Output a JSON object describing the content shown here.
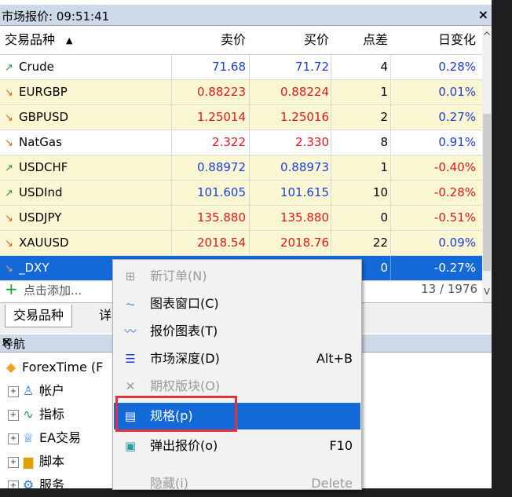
{
  "market_watch": {
    "title": "市场报价: 09:51:41",
    "close": "×",
    "headers": {
      "symbol": "交易品种",
      "bid": "卖价",
      "ask": "买价",
      "spread": "点差",
      "change": "日变化"
    },
    "sort_glyph": "▲",
    "rows": [
      {
        "dir": "↗",
        "symbol": "Crude",
        "bid": "71.68",
        "ask": "71.72",
        "spread": "4",
        "change": "0.28%"
      },
      {
        "dir": "↘",
        "symbol": "EURGBP",
        "bid": "0.88223",
        "ask": "0.88224",
        "spread": "1",
        "change": "0.01%"
      },
      {
        "dir": "↘",
        "symbol": "GBPUSD",
        "bid": "1.25014",
        "ask": "1.25016",
        "spread": "2",
        "change": "0.27%"
      },
      {
        "dir": "↘",
        "symbol": "NatGas",
        "bid": "2.322",
        "ask": "2.330",
        "spread": "8",
        "change": "0.91%"
      },
      {
        "dir": "↗",
        "symbol": "USDCHF",
        "bid": "0.88972",
        "ask": "0.88973",
        "spread": "1",
        "change": "-0.40%"
      },
      {
        "dir": "↗",
        "symbol": "USDInd",
        "bid": "101.605",
        "ask": "101.615",
        "spread": "10",
        "change": "-0.28%"
      },
      {
        "dir": "↘",
        "symbol": "USDJPY",
        "bid": "135.880",
        "ask": "135.880",
        "spread": "0",
        "change": "-0.51%"
      },
      {
        "dir": "↘",
        "symbol": "XAUUSD",
        "bid": "2018.54",
        "ask": "2018.76",
        "spread": "22",
        "change": "0.09%"
      },
      {
        "dir": "↘",
        "symbol": "_DXY",
        "bid": "",
        "ask": "",
        "spread": "0",
        "change": "-0.27%"
      }
    ],
    "add_row": {
      "plus": "+",
      "label": "点击添加...",
      "count": "13 / 1976"
    },
    "tabs": {
      "symbols": "交易品种",
      "details": "详"
    }
  },
  "navigator": {
    "title": "导航",
    "close": "×",
    "items": [
      {
        "label": "ForexTime (F",
        "icon": "forextime-logo-icon"
      },
      {
        "label": "帐户",
        "icon": "accounts-icon"
      },
      {
        "label": "指标",
        "icon": "indicators-icon"
      },
      {
        "label": "EA交易",
        "icon": "expert-advisors-icon"
      },
      {
        "label": "脚本",
        "icon": "scripts-icon"
      },
      {
        "label": "服务",
        "icon": "services-icon"
      }
    ],
    "expander": "+"
  },
  "context_menu": {
    "items": [
      {
        "label": "新订单(N)",
        "shortcut": "",
        "icon": "new-order-icon",
        "state": "disabled"
      },
      {
        "label": "图表窗口(C)",
        "shortcut": "",
        "icon": "chart-window-icon",
        "state": "normal"
      },
      {
        "label": "报价图表(T)",
        "shortcut": "",
        "icon": "tick-chart-icon",
        "state": "normal"
      },
      {
        "label": "市场深度(D)",
        "shortcut": "Alt+B",
        "icon": "depth-of-market-icon",
        "state": "normal"
      },
      {
        "label": "期权版块(O)",
        "shortcut": "",
        "icon": "options-board-icon",
        "state": "disabled"
      },
      {
        "label": "规格(p)",
        "shortcut": "",
        "icon": "specification-icon",
        "state": "highlighted"
      },
      {
        "label": "弹出报价(o)",
        "shortcut": "F10",
        "icon": "popup-prices-icon",
        "state": "normal"
      },
      {
        "label": "隐藏(i)",
        "shortcut": "Delete",
        "icon": "",
        "state": "disabled"
      }
    ]
  },
  "colors": {
    "selection_blue": "#1469d9",
    "highlight_box": "#e0333c",
    "yellow_row": "#fbf7d2",
    "up_green": "#2a9a3e",
    "down_orange": "#e06010"
  }
}
